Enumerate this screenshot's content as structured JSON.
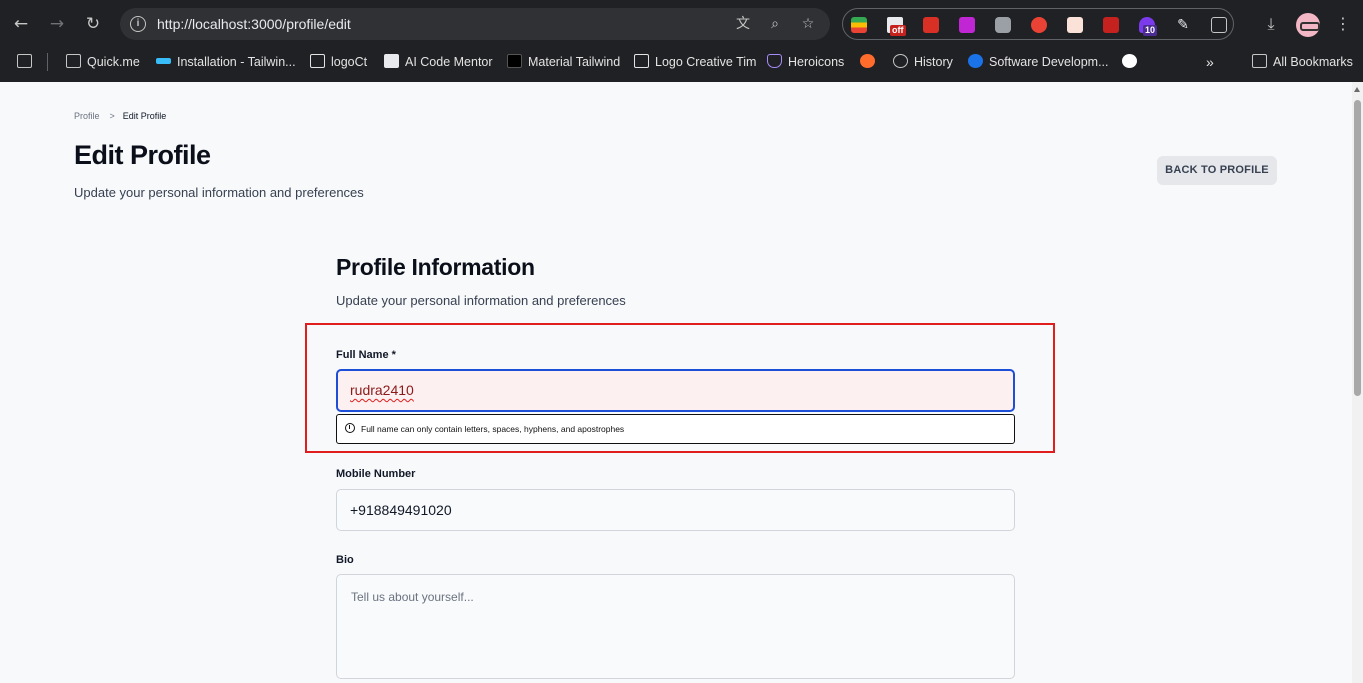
{
  "browser": {
    "url": "http://localhost:3000/profile/edit",
    "extension_badges": {
      "off": "off",
      "count": "10"
    },
    "bookmarks": [
      {
        "label": "Quick.me"
      },
      {
        "label": "Installation - Tailwin..."
      },
      {
        "label": "logoCt"
      },
      {
        "label": "AI Code Mentor"
      },
      {
        "label": "Material Tailwind"
      },
      {
        "label": "Logo Creative Tim"
      },
      {
        "label": "Heroicons"
      },
      {
        "label": ""
      },
      {
        "label": "History"
      },
      {
        "label": "Software Developm..."
      },
      {
        "label": ""
      }
    ],
    "all_bookmarks": "All Bookmarks",
    "overflow": "»"
  },
  "breadcrumb": {
    "parent": "Profile",
    "separator": ">",
    "current": "Edit Profile"
  },
  "header": {
    "title": "Edit Profile",
    "subtitle": "Update your personal information and preferences",
    "back_button": "BACK TO PROFILE"
  },
  "form": {
    "title": "Profile Information",
    "subtitle": "Update your personal information and preferences",
    "full_name": {
      "label": "Full Name *",
      "value": "rudra2410",
      "error": "Full name can only contain letters, spaces, hyphens, and apostrophes"
    },
    "mobile": {
      "label": "Mobile Number",
      "value": "+918849491020"
    },
    "bio": {
      "label": "Bio",
      "placeholder": "Tell us about yourself..."
    }
  },
  "colors": {
    "highlight": "#e11d1d",
    "focus_border": "#1d4ed8",
    "error_bg": "#fdf0f0"
  }
}
